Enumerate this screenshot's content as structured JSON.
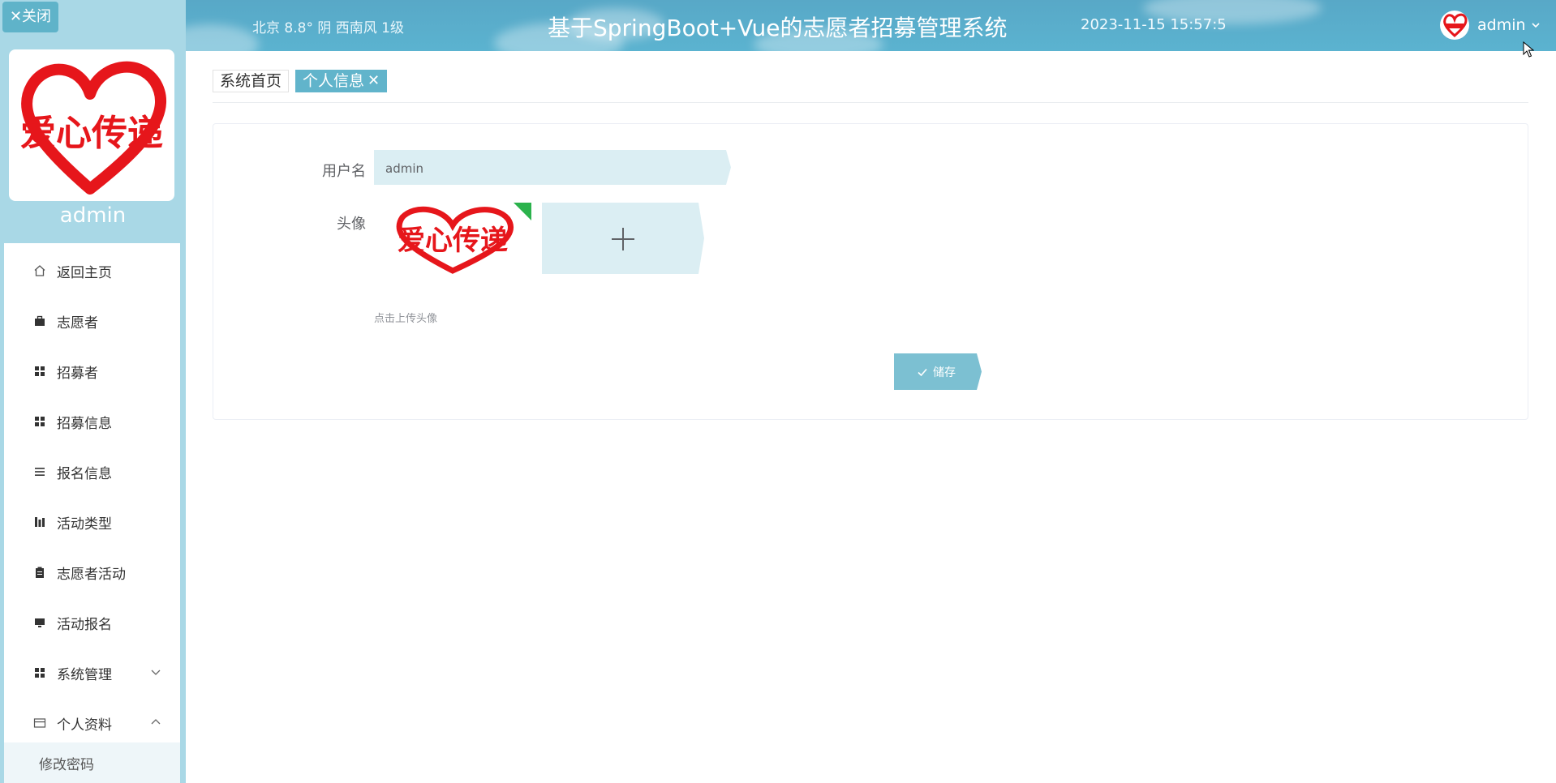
{
  "sidebar": {
    "close_label": "✕关闭",
    "logo_text": "爱心传递",
    "username": "admin",
    "items": [
      {
        "label": "返回主页",
        "icon": "home-icon"
      },
      {
        "label": "志愿者",
        "icon": "briefcase-icon"
      },
      {
        "label": "招募者",
        "icon": "grid-icon"
      },
      {
        "label": "招募信息",
        "icon": "grid-icon"
      },
      {
        "label": "报名信息",
        "icon": "list-icon"
      },
      {
        "label": "活动类型",
        "icon": "chart-icon"
      },
      {
        "label": "志愿者活动",
        "icon": "clipboard-icon"
      },
      {
        "label": "活动报名",
        "icon": "monitor-icon"
      },
      {
        "label": "系统管理",
        "icon": "grid-icon",
        "expanded": false
      },
      {
        "label": "个人资料",
        "icon": "card-icon",
        "expanded": true
      }
    ],
    "subitems": [
      {
        "label": "修改密码"
      }
    ]
  },
  "header": {
    "weather": "北京  8.8°  阴  西南风  1级",
    "title": "基于SpringBoot+Vue的志愿者招募管理系统",
    "datetime": "2023-11-15 15:57:5",
    "user": "admin"
  },
  "tabs": [
    {
      "label": "系统首页",
      "active": false
    },
    {
      "label": "个人信息",
      "active": true,
      "close": "✕"
    }
  ],
  "form": {
    "username_label": "用户名",
    "username_value": "admin",
    "avatar_label": "头像",
    "avatar_text": "爱心传递",
    "upload_hint": "点击上传头像",
    "save_label": "储存"
  },
  "colors": {
    "sidebar_bg": "#a9d8e6",
    "accent": "#61b4cb",
    "field_bg": "#dbeef3",
    "button_bg": "#7cc0d2",
    "logo_red": "#e6161b"
  }
}
